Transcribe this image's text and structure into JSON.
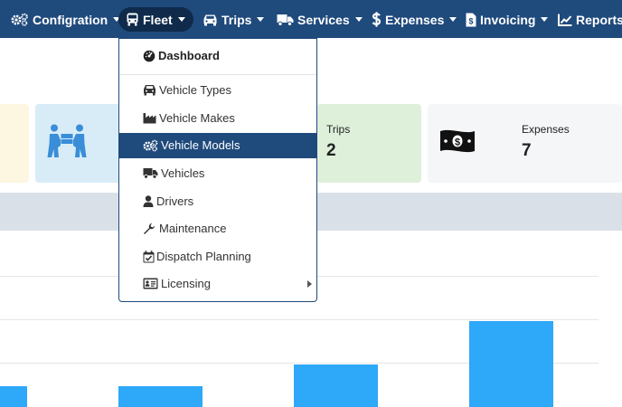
{
  "navbar": {
    "items": [
      {
        "label": "Configration",
        "icon": "gears-icon",
        "has_caret": true
      },
      {
        "label": "Fleet",
        "icon": "bus-icon",
        "has_caret": true,
        "active": true
      },
      {
        "label": "Trips",
        "icon": "car-icon",
        "has_caret": true
      },
      {
        "label": "Services",
        "icon": "truck-icon",
        "has_caret": true
      },
      {
        "label": "Expenses",
        "icon": "dollar-icon",
        "has_caret": true
      },
      {
        "label": "Invoicing",
        "icon": "invoice-icon",
        "has_caret": true
      },
      {
        "label": "Reports",
        "icon": "line-chart-icon",
        "has_caret": false
      }
    ]
  },
  "fleet_menu": {
    "header": {
      "label": "Dashboard",
      "icon": "tachometer-icon"
    },
    "items": [
      {
        "label": "Vehicle Types",
        "icon": "car-icon"
      },
      {
        "label": "Vehicle Makes",
        "icon": "industry-icon"
      },
      {
        "label": "Vehicle Models",
        "icon": "gears-icon",
        "active": true
      },
      {
        "label": "Vehicles",
        "icon": "truck-icon"
      },
      {
        "label": "Drivers",
        "icon": "user-icon"
      },
      {
        "label": "Maintenance",
        "icon": "wrench-icon"
      },
      {
        "label": "Dispatch Planning",
        "icon": "calendar-check-icon"
      },
      {
        "label": "Licensing",
        "icon": "id-card-icon",
        "has_submenu": true
      }
    ]
  },
  "cards": {
    "trips": {
      "label": "Trips",
      "value": "2"
    },
    "expenses": {
      "label": "Expenses",
      "value": "7",
      "icon": "money-icon"
    },
    "people": {
      "icon": "people-carry-icon"
    }
  },
  "colors": {
    "navbar": "#1f4a7c",
    "active_nav": "#0f2a4b",
    "bar": "#2ea8f8",
    "card_yellow": "#fdf6e1",
    "card_blue": "#d8ecf8",
    "card_green": "#def0da",
    "card_gray": "#f4f6f8"
  }
}
